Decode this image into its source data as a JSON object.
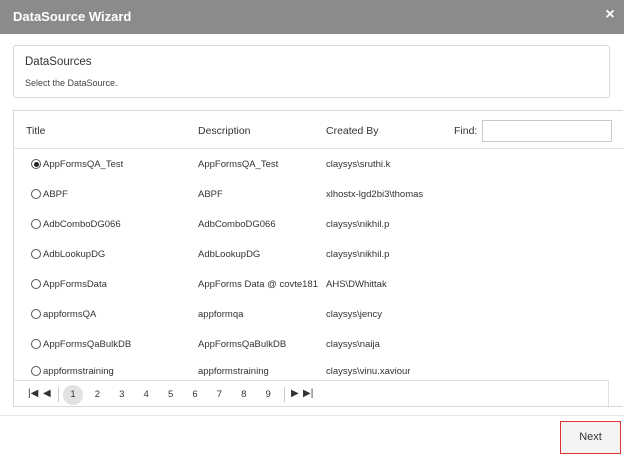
{
  "window": {
    "title": "DataSource Wizard",
    "close_glyph": "×"
  },
  "datasources_panel": {
    "heading": "DataSources",
    "subtext": "Select the DataSource."
  },
  "grid": {
    "headers": {
      "title": "Title",
      "description": "Description",
      "created_by": "Created By",
      "find": "Find:"
    },
    "find_value": "",
    "rows": [
      {
        "title": "AppFormsQA_Test",
        "description": "AppFormsQA_Test",
        "created_by": "claysys\\sruthi.k",
        "selected": true
      },
      {
        "title": "ABPF",
        "description": "ABPF",
        "created_by": "xlhostx-lgd2bi3\\thomas",
        "selected": false
      },
      {
        "title": "AdbComboDG066",
        "description": "AdbComboDG066",
        "created_by": "claysys\\nikhil.p",
        "selected": false
      },
      {
        "title": "AdbLookupDG",
        "description": "AdbLookupDG",
        "created_by": "claysys\\nikhil.p",
        "selected": false
      },
      {
        "title": "AppFormsData",
        "description": "AppForms Data @ covte181",
        "created_by": "AHS\\DWhittak",
        "selected": false
      },
      {
        "title": "appformsQA",
        "description": "appformqa",
        "created_by": "claysys\\jency",
        "selected": false
      },
      {
        "title": "AppFormsQaBulkDB",
        "description": "AppFormsQaBulkDB",
        "created_by": "claysys\\naija",
        "selected": false
      },
      {
        "title": "appformstraining",
        "description": "appformstraining",
        "created_by": "claysys\\vinu.xaviour",
        "selected": false
      }
    ]
  },
  "pager": {
    "first_glyph": "|◀",
    "prev_glyph": "◀",
    "next_glyph": "▶",
    "last_glyph": "▶|",
    "pages": [
      "1",
      "2",
      "3",
      "4",
      "5",
      "6",
      "7",
      "8",
      "9"
    ],
    "current_page": "1"
  },
  "footer": {
    "next_label": "Next"
  },
  "colors": {
    "titlebar": "#898b8c",
    "next_border": "#dd3333",
    "active_page": "#e2e2e2"
  }
}
